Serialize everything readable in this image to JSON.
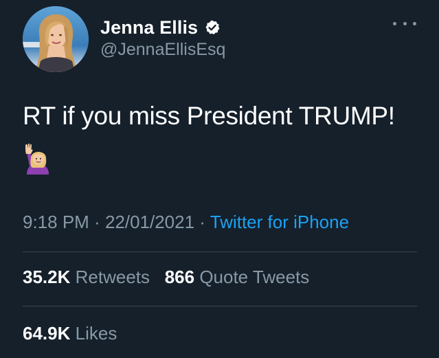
{
  "author": {
    "display_name": "Jenna Ellis",
    "handle": "@JennaEllisEsq",
    "verified": true
  },
  "tweet": {
    "text": "RT if you miss President TRUMP!",
    "emoji": "🙋🏼‍♀️",
    "time": "9:18 PM",
    "date": "22/01/2021",
    "separator": " · ",
    "source": "Twitter for iPhone"
  },
  "stats": {
    "retweets_count": "35.2K",
    "retweets_label": "Retweets",
    "quote_tweets_count": "866",
    "quote_tweets_label": "Quote Tweets",
    "likes_count": "64.9K",
    "likes_label": "Likes"
  },
  "colors": {
    "background": "#15202b",
    "text_primary": "#ffffff",
    "text_secondary": "#8899a6",
    "accent": "#1da1f2",
    "divider": "#38444d"
  },
  "icons": {
    "verified": "verified-badge-icon",
    "more": "more-horizontal-icon"
  }
}
